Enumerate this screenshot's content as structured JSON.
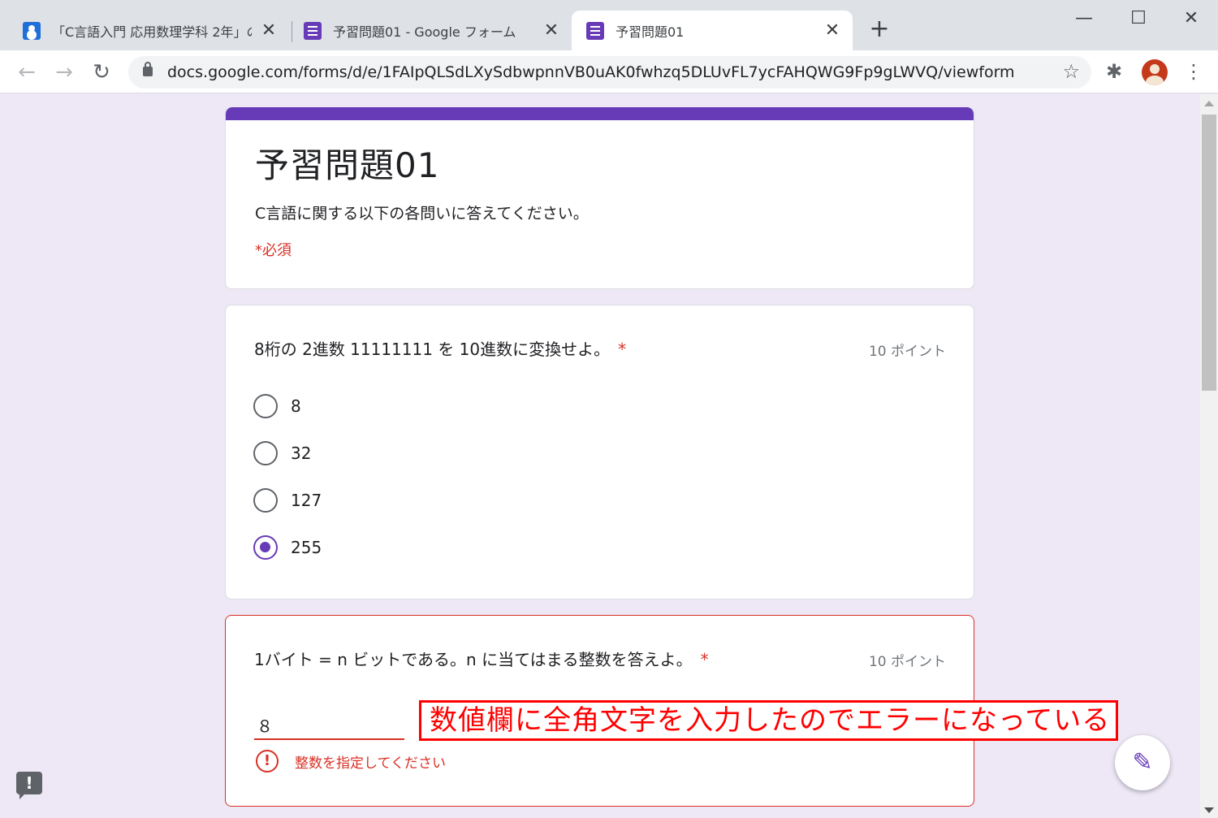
{
  "browser": {
    "tabs": [
      {
        "title": "「C言語入門 応用数理学科 2年」の",
        "icon": "classroom-icon",
        "close": "✕"
      },
      {
        "title": "予習問題01 - Google フォーム",
        "icon": "google-forms-icon",
        "close": "✕"
      },
      {
        "title": "予習問題01",
        "icon": "google-forms-icon",
        "close": "✕"
      }
    ],
    "new_tab": "+",
    "window_controls": {
      "minimize": "—",
      "maximize": "☐",
      "close": "✕"
    },
    "nav": {
      "back": "←",
      "forward": "→",
      "reload": "↻"
    },
    "url": "docs.google.com/forms/d/e/1FAIpQLSdLXySdbwpnnVB0uAK0fwhzq5DLUvFL7ycFAHQWG9Fp9gLWVQ/viewform",
    "star": "☆",
    "extensions": "✱",
    "menu": "⋮"
  },
  "form": {
    "title": "予習問題01",
    "description": "C言語に関する以下の各問いに答えてください。",
    "required_note": "*必須",
    "accent_color": "#673ab7"
  },
  "question1": {
    "text": "8桁の 2進数 11111111 を 10進数に変換せよ。",
    "required_mark": "*",
    "points": "10 ポイント",
    "options": [
      "8",
      "32",
      "127",
      "255"
    ],
    "selected": "255"
  },
  "question2": {
    "text": "1バイト = n ビットである。n に当てはまる整数を答えよ。",
    "required_mark": "*",
    "points": "10 ポイント",
    "answer_value": "８",
    "error_text": "整数を指定してください",
    "error_icon": "!"
  },
  "annotation": {
    "text": "数値欄に全角文字を入力したのでエラーになっている",
    "color": "#ff0000"
  },
  "fab": {
    "icon": "✎"
  },
  "feedback": {
    "icon": "!"
  }
}
